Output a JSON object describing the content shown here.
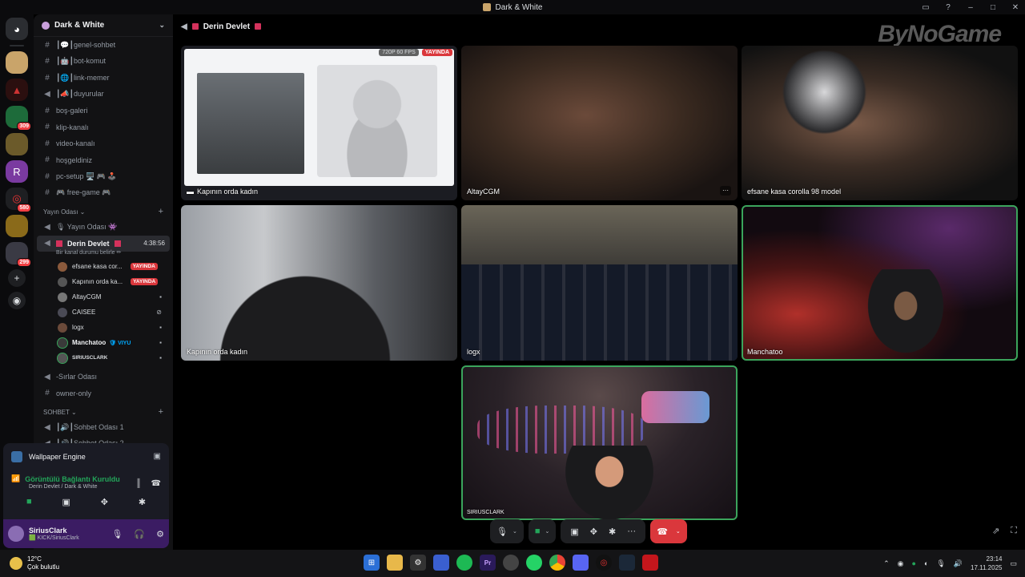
{
  "window": {
    "title": "Dark & White"
  },
  "server": {
    "name": "Dark & White"
  },
  "rail": {
    "badges": [
      "309",
      "580",
      "299"
    ]
  },
  "channels": [
    {
      "icon": "#",
      "name": "┃💬┃genel-sohbet"
    },
    {
      "icon": "#",
      "name": "┃🤖┃bot-komut"
    },
    {
      "icon": "#",
      "name": "┃🌐┃link-memer"
    },
    {
      "icon": "📢",
      "name": "┃📣┃duyurular"
    },
    {
      "icon": "#",
      "name": "boş-galeri"
    },
    {
      "icon": "#",
      "name": "klip-kanalı"
    },
    {
      "icon": "#",
      "name": "video-kanalı"
    },
    {
      "icon": "#",
      "name": "hoşgeldiniz"
    },
    {
      "icon": "#",
      "name": "pc-setup 🖥️ 🎮 🕹️"
    },
    {
      "icon": "#",
      "name": "🎮 free-game 🎮"
    }
  ],
  "category_stream": {
    "label": "Yayın Odası ⌄"
  },
  "stream_channels": [
    {
      "name": "🎙 Yayın Odası 👾"
    }
  ],
  "active_channel": {
    "name": "Derin Devlet",
    "timer": "4:38:56",
    "status": "Bir kanal durumu belirle ✏"
  },
  "voice_users": [
    {
      "name": "efsane kasa cor...",
      "live": "YAYINDA",
      "cam": ""
    },
    {
      "name": "Kapının orda ka...",
      "live": "YAYINDA",
      "cam": ""
    },
    {
      "name": "AltayCGM",
      "live": "",
      "cam": "▪"
    },
    {
      "name": "CAISEE",
      "live": "",
      "cam": "⊘"
    },
    {
      "name": "logx",
      "live": "",
      "cam": "▪"
    },
    {
      "name": "Manchatoo",
      "live": "",
      "cam": "▪",
      "tag": "🛡 VIYU"
    },
    {
      "name": "SIRIUSCLARK",
      "live": "",
      "cam": "▪"
    }
  ],
  "more_channels": [
    {
      "icon": "🔊",
      "name": "-Sırlar Odası"
    },
    {
      "icon": "🔊",
      "name": "owner-only"
    }
  ],
  "category_chat": {
    "label": "SOHBET ⌄"
  },
  "chat_channels": [
    {
      "name": "┃🔊┃Sohbet Odası 1"
    },
    {
      "name": "┃🔊┃Sohbet Odası 2"
    }
  ],
  "activity": {
    "name": "Wallpaper Engine"
  },
  "voice_panel": {
    "title": "Görüntülü Bağlantı Kuruldu",
    "subtitle": "Derin Devlet / Dark & White"
  },
  "user": {
    "name": "SiriusClark",
    "status": "🟩 KICK/SiriusClark"
  },
  "header": {
    "channel": "Derin Devlet"
  },
  "watermark": "ByNoGame",
  "stream_badges": {
    "quality": "720P 60 FPS",
    "live": "YAYINDA"
  },
  "tiles": [
    {
      "label": "Kapının orda kadın",
      "stream": true
    },
    {
      "label": "AltayCGM",
      "more": "···"
    },
    {
      "label": "efsane kasa corolla 98 model"
    },
    {
      "label": "Kapının orda kadın"
    },
    {
      "label": "logx"
    },
    {
      "label": "Manchatoo",
      "speaking": true
    },
    {
      "label": "SIRIUSCLARK",
      "speaking": true
    }
  ],
  "taskbar": {
    "weather_temp": "12°C",
    "weather_desc": "Çok bulutlu",
    "time": "23:14",
    "date": "17.11.2025"
  }
}
